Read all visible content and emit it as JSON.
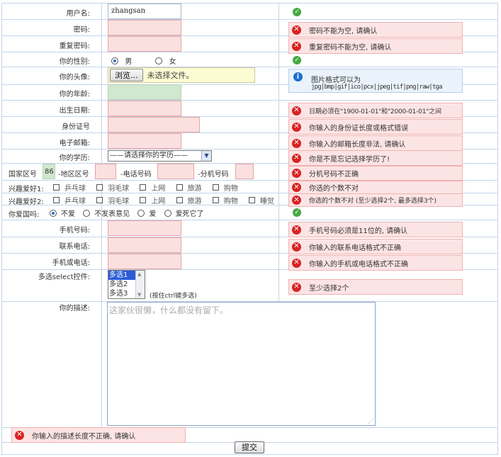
{
  "labels": {
    "username": "用户名:",
    "password": "密码:",
    "repassword": "重复密码:",
    "gender": "你的性别:",
    "avatar": "你的头像:",
    "age": "你的年龄:",
    "birthday": "出生日期:",
    "idcard": "身份证号",
    "email": "电子邮箱:",
    "education": "你的学历:",
    "country_code": "国家区号",
    "area_code": "-地区区号",
    "phone": "-电话号码",
    "ext": "-分机号码",
    "hobby1": "兴趣爱好1:",
    "hobby2": "兴趣爱好2:",
    "patriot": "你爱国吗:",
    "mobile": "手机号码:",
    "contact": "联系电话:",
    "mobile_or_phone": "手机或电话:",
    "multiselect": "多选select控件:",
    "description": "你的描述:"
  },
  "values": {
    "username": "zhangsan",
    "country_code": "86",
    "file_button": "浏览...",
    "file_status": "未选择文件。",
    "education_selected": "——请选择你的学历——",
    "multiselect_hint": "(按住ctrl键多选)",
    "description_placeholder": "这家伙很懒，什么都没有留下。",
    "submit": "提交"
  },
  "gender_options": [
    "男",
    "女"
  ],
  "hobby1_options": [
    "乒乓球",
    "羽毛球",
    "上网",
    "旅游",
    "购物"
  ],
  "hobby2_options": [
    "乒乓球",
    "羽毛球",
    "上网",
    "旅游",
    "购物",
    "睡觉"
  ],
  "patriot_options": [
    "不爱",
    "不发表意见",
    "爱",
    "爱死它了"
  ],
  "multiselect_options": [
    "多选1",
    "多选2",
    "多选3"
  ],
  "messages": {
    "password": "密码不能为空, 请确认",
    "repassword": "重复密码不能为空, 请确认",
    "avatar_line1": "图片格式可以为",
    "avatar_line2": "jpg|bmp|gif|ico|pcx|jpeg|tif|png|raw|tga",
    "birthday": "日期必须在\"1900-01-01\"和\"2000-01-01\"之间",
    "idcard": "你输入的身份证长度或格式错误",
    "email": "你输入的邮箱长度非法, 请确认",
    "education": "你是不是忘记选择学历了!",
    "phone": "分机号码不正确",
    "hobby1": "你选的个数不对",
    "hobby2": "你选的个数不对 (至少选择2个, 最多选择3个)",
    "mobile": "手机号码必须是11位的, 请确认",
    "contact": "你输入的联系电话格式不正确",
    "mobile_or_phone": "你输入的手机或电话格式不正确",
    "multiselect": "至少选择2个",
    "description": "你输入的描述长度不正确, 请确认"
  },
  "colors": {
    "error_bg": "#fde4e4",
    "error_icon": "#d92323",
    "ok_icon": "#45a844",
    "info_icon": "#1a6fd0",
    "invalid_input_bg": "#fbe0e0",
    "border": "#c4d5ea"
  },
  "icons": {
    "error": "error-icon",
    "ok": "check-icon",
    "info": "info-icon"
  }
}
